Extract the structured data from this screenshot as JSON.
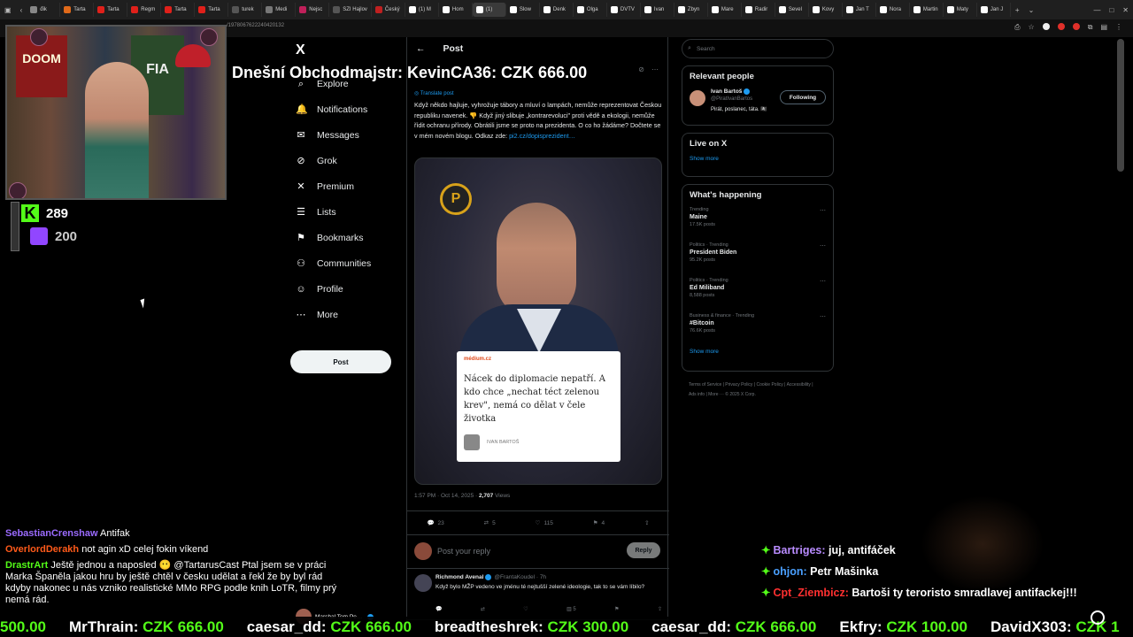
{
  "browser": {
    "tabs": [
      {
        "label": "đik",
        "color": "#888"
      },
      {
        "label": "Tarta",
        "color": "#e06a1a"
      },
      {
        "label": "Tarta",
        "color": "#e0201a"
      },
      {
        "label": "Regm",
        "color": "#e0201a"
      },
      {
        "label": "Tarta",
        "color": "#e0201a"
      },
      {
        "label": "Tarta",
        "color": "#e0201a"
      },
      {
        "label": "turek",
        "color": "#555"
      },
      {
        "label": "Medi",
        "color": "#777"
      },
      {
        "label": "Nejsc",
        "color": "#c0205a"
      },
      {
        "label": "SZI Hajlov",
        "color": "#555"
      },
      {
        "label": "Český",
        "color": "#c02020"
      },
      {
        "label": "(1) M",
        "color": "#fff"
      },
      {
        "label": "Hom",
        "color": "#fff"
      },
      {
        "label": "(1)",
        "color": "#fff"
      },
      {
        "label": "Slow",
        "color": "#fff"
      },
      {
        "label": "Denk",
        "color": "#fff"
      },
      {
        "label": "Olga",
        "color": "#fff"
      },
      {
        "label": "DVTV",
        "color": "#fff"
      },
      {
        "label": "Ivan",
        "color": "#fff"
      },
      {
        "label": "Zbyn",
        "color": "#fff"
      },
      {
        "label": "Mare",
        "color": "#fff"
      },
      {
        "label": "Radir",
        "color": "#fff"
      },
      {
        "label": "Sevel",
        "color": "#fff"
      },
      {
        "label": "Kovy",
        "color": "#fff"
      },
      {
        "label": "Jan T",
        "color": "#fff"
      },
      {
        "label": "Nora",
        "color": "#fff"
      },
      {
        "label": "Martin",
        "color": "#fff"
      },
      {
        "label": "Maty",
        "color": "#fff"
      },
      {
        "label": "Jan J",
        "color": "#fff"
      }
    ],
    "active_tab_index": 13,
    "url": "/1978067622240420132"
  },
  "stream": {
    "headline": "Dnešní Obchodmajstr: KevinCA36: CZK 666.00",
    "kick_count": "289",
    "twitch_count": "200",
    "kick_glyph": "K",
    "poster1": "DOOM",
    "poster2": "FIA",
    "colors": {
      "kick": "#53fc18",
      "twitch": "#9146ff"
    }
  },
  "nav": {
    "logo": "X",
    "items": [
      {
        "label": "Explore",
        "icon": "search-icon",
        "glyph": "⌕"
      },
      {
        "label": "Notifications",
        "icon": "bell-icon",
        "glyph": "🔔"
      },
      {
        "label": "Messages",
        "icon": "envelope-icon",
        "glyph": "✉"
      },
      {
        "label": "Grok",
        "icon": "grok-icon",
        "glyph": "⊘"
      },
      {
        "label": "Premium",
        "icon": "x-premium-icon",
        "glyph": "✕"
      },
      {
        "label": "Lists",
        "icon": "list-icon",
        "glyph": "☰"
      },
      {
        "label": "Bookmarks",
        "icon": "bookmark-icon",
        "glyph": "⚑"
      },
      {
        "label": "Communities",
        "icon": "people-icon",
        "glyph": "⚇"
      },
      {
        "label": "Profile",
        "icon": "person-icon",
        "glyph": "☺"
      },
      {
        "label": "More",
        "icon": "more-circle-icon",
        "glyph": "⋯"
      }
    ],
    "post_button": "Post"
  },
  "post": {
    "header": "Post",
    "translate": "Translate post",
    "text": "Když někdo hajluje, vyhrožuje tábory a mluví o lampách, nemůže reprezentovat Českou republiku navenek. 👎 Když jiný slibuje „kontrarevoluci\" proti vědě a ekologii, nemůže řídit ochranu přírody. Obrátili jsme se proto na prezidenta. O co ho žádáme? Dočtete se v mém novém blogu. Odkaz zde: ",
    "link": "pi2.cz/dopisprezident…",
    "media": {
      "source": "médium.cz",
      "quote": "Nácek do diplomacie nepatří. A kdo chce „nechat téct zelenou krev\", nemá co dělat v čele životka",
      "byline": "IVAN BARTOŠ",
      "party_logo": "P"
    },
    "time": "1:57 PM · Oct 14, 2025 · ",
    "views_count": "2,707",
    "views_label": " Views",
    "actions": {
      "replies": "23",
      "reposts": "5",
      "likes": "115",
      "bookmarks": "4"
    },
    "reply_placeholder": "Post your reply",
    "reply_button": "Reply"
  },
  "reply": {
    "name": "Richmond Avenal",
    "handle": "@FrantaKoudel · 7h",
    "text": "Když bylo MŽP vedeno ve jménu té nejtušší zelené ideologie, tak to se vám líbilo?",
    "views": "5"
  },
  "sidebar": {
    "search_placeholder": "Search",
    "relevant_title": "Relevant people",
    "person": {
      "name": "Ivan Bartoš",
      "handle": "@PiratIvanBartos",
      "bio": "Pirát, poslanec, táta. 🏴‍☠️",
      "follow_label": "Following"
    },
    "live_title": "Live on X",
    "show_more": "Show more",
    "happening_title": "What's happening",
    "trends": [
      {
        "context": "Trending",
        "title": "Maine",
        "count": "17.5K posts"
      },
      {
        "context": "Politics · Trending",
        "title": "President Biden",
        "count": "95.2K posts"
      },
      {
        "context": "Politics · Trending",
        "title": "Ed Miliband",
        "count": "8,588 posts"
      },
      {
        "context": "Business & finance · Trending",
        "title": "#Bitcoin",
        "count": "76.6K posts"
      }
    ],
    "footer": "Terms of Service | Privacy Policy | Cookie Policy | Accessibility | Ads info | More ··· © 2025 X Corp."
  },
  "chat_left": [
    {
      "user": "SebastianCrenshaw",
      "color": "#9b6bff",
      "text": "Antifak"
    },
    {
      "user": "OverlordDerakh",
      "color": "#ff5a1a",
      "text": "not agin xD celej fokin víkend"
    },
    {
      "user": "DrastrArt",
      "color": "#53fc18",
      "text": "Ještě jednou a naposled 😶 @TartarusCast Ptal jsem se v práci Marka Španěla jakou hru by ještě chtěl v česku udělat a řekl že by byl rád kdyby nakonec u nás vzniko realistické MMo RPG podle knih LoTR, filmy prý nemá rád."
    }
  ],
  "chat_right": [
    {
      "user": "Bartriges:",
      "color": "#b98cff",
      "text": "juj, antifáček"
    },
    {
      "user": "ohjon:",
      "color": "#4aa0ff",
      "text": "Petr Mašinka"
    },
    {
      "user": "Cpt_Ziembicz:",
      "color": "#ff3030",
      "text": "Bartoši ty teroristo smradlavej antifackej!!!"
    }
  ],
  "snippet": "Marshal Tom Pe…",
  "ticker": [
    {
      "name": "",
      "amount": "500.00"
    },
    {
      "name": "MrThrain:",
      "amount": "CZK 666.00"
    },
    {
      "name": "caesar_dd:",
      "amount": "CZK 666.00"
    },
    {
      "name": "breadtheshrek:",
      "amount": "CZK 300.00"
    },
    {
      "name": "caesar_dd:",
      "amount": "CZK 666.00"
    },
    {
      "name": "Ekfry:",
      "amount": "CZK 100.00"
    },
    {
      "name": "DavidX303:",
      "amount": "CZK 1"
    }
  ]
}
